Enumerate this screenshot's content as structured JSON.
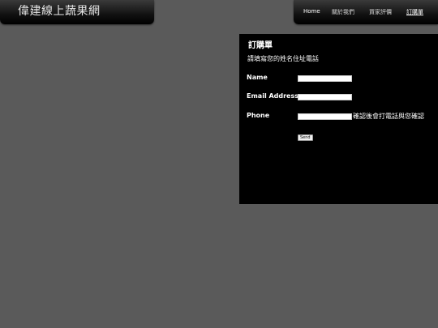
{
  "site": {
    "logo_text": "偉建線上蔬果網"
  },
  "nav": {
    "items": [
      {
        "label": "Home"
      },
      {
        "label": "關於我們"
      },
      {
        "label": "買家評價"
      },
      {
        "label": "訂購單"
      }
    ]
  },
  "order_form": {
    "title": "訂購單",
    "subtitle": "請填寫您的姓名住址電話",
    "fields": [
      {
        "label": "Name",
        "value": ""
      },
      {
        "label": "Email Address",
        "value": ""
      },
      {
        "label": "Phone",
        "value": "",
        "note": "確認後會打電話與您確認"
      }
    ],
    "submit_label": "Send"
  },
  "colors": {
    "page_background": "#5a5a5a",
    "panel_background": "#000000",
    "text": "#ffffff"
  }
}
